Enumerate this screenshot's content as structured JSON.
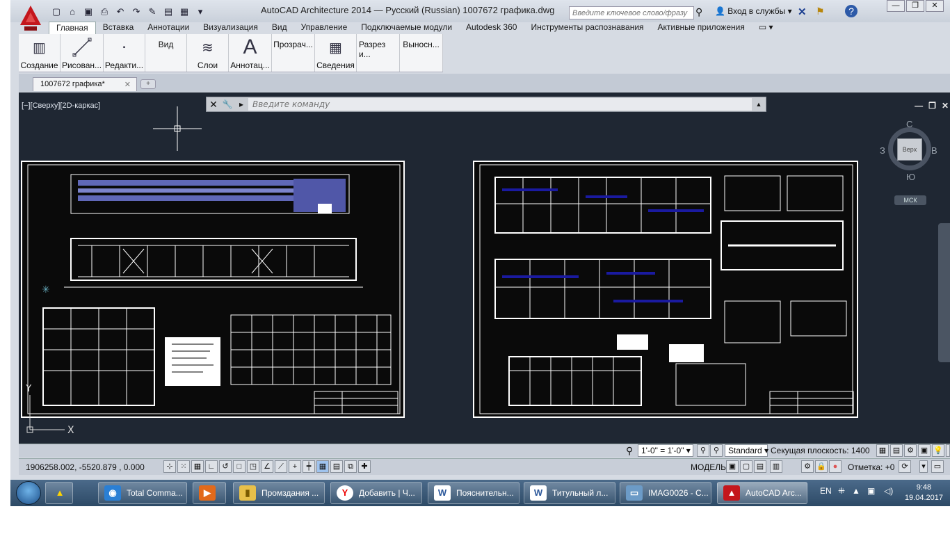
{
  "titlebar": {
    "window_title": "AutoCAD Architecture 2014 — Русский (Russian)      1007672 графика.dwg",
    "search_placeholder": "Введите ключевое слово/фразу",
    "login": "Вход в службы"
  },
  "tabs": [
    "Главная",
    "Вставка",
    "Аннотации",
    "Визуализация",
    "Вид",
    "Управление",
    "Подключаемые модули",
    "Autodesk 360",
    "Инструменты распознавания",
    "Активные приложения"
  ],
  "ribbon": [
    "Создание",
    "Рисован...",
    "Редакти...",
    "Вид",
    "Слои",
    "Аннотац...",
    "Прозрач...",
    "Сведения",
    "Разрез и...",
    "Выносн..."
  ],
  "file_tab": "1007672 графика*",
  "viewport": {
    "label": "[−][Сверху][2D-каркас]",
    "command_placeholder": "Введите команду"
  },
  "viewcube": {
    "top": "Верх",
    "n": "С",
    "s": "Ю",
    "w": "З",
    "e": "В",
    "ucs": "МСК"
  },
  "status": {
    "coords": "1906258.002, -5520.879 , 0.000",
    "scale": "1'-0\" = 1'-0\"",
    "style": "Standard",
    "cut_plane": "Секущая плоскость:  1400",
    "model": "МОДЕЛЬ",
    "elevation": "Отметка: +0"
  },
  "taskbar": {
    "items": [
      "Total Comma...",
      "",
      "Промздания ...",
      "Добавить | Ч...",
      "Пояснительн...",
      "Титульный л...",
      "IMAG0026 - С...",
      "AutoCAD Arc..."
    ],
    "lang": "EN",
    "time": "9:48",
    "date": "19.04.2017"
  }
}
